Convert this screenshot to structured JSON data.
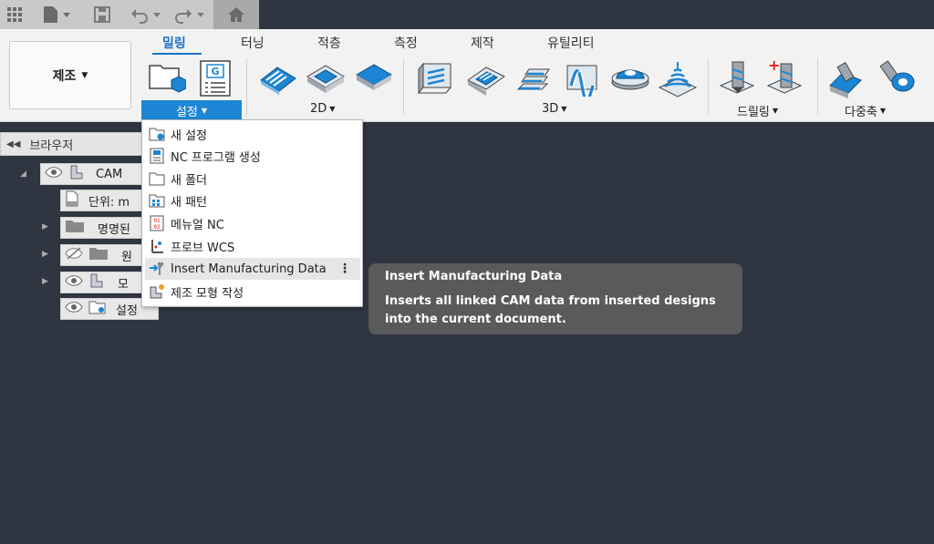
{
  "ribbon": {
    "workspace_label": "제조",
    "tabs": [
      "밀링",
      "터닝",
      "적층",
      "측정",
      "제작",
      "유틸리티"
    ],
    "groups": {
      "setup": "설정",
      "g2d": "2D",
      "g3d": "3D",
      "drilling": "드릴링",
      "multiaxis": "다중축"
    }
  },
  "browser": {
    "title": "브라우저",
    "rows": [
      "CAM",
      "단위: m",
      "명명된",
      "원",
      "모",
      "설정"
    ]
  },
  "menu": {
    "items": [
      "새 설정",
      "NC 프로그램 생성",
      "새 폴더",
      "새 패턴",
      "메뉴얼 NC",
      "프로브 WCS",
      "Insert Manufacturing Data",
      "제조 모형 작성"
    ],
    "more_glyph": "⋮",
    "nc_icon_text": "01 02"
  },
  "tooltip": {
    "title": "Insert Manufacturing Data",
    "desc_line1": "Inserts all linked CAM data from inserted designs",
    "desc_line2": "into the current document."
  },
  "colors": {
    "accent": "#1d86d4",
    "canvas": "#2f3641",
    "tooltip_bg": "#5a5a5a"
  }
}
